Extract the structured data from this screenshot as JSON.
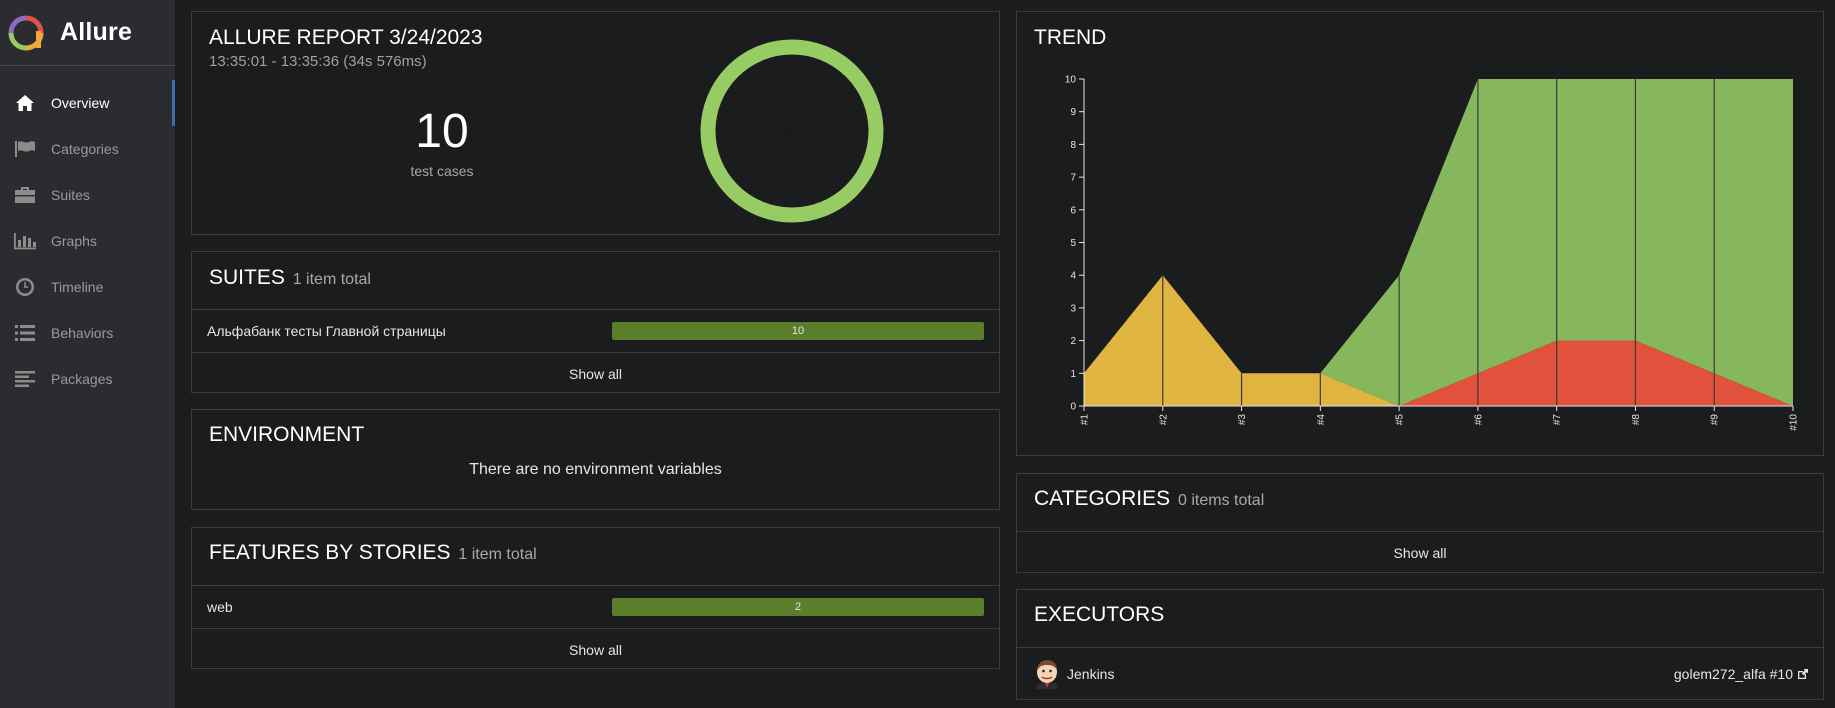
{
  "app": {
    "name": "Allure"
  },
  "sidebar": {
    "items": [
      {
        "label": "Overview",
        "icon": "home-icon",
        "active": true
      },
      {
        "label": "Categories",
        "icon": "flag-icon"
      },
      {
        "label": "Suites",
        "icon": "briefcase-icon"
      },
      {
        "label": "Graphs",
        "icon": "bar-chart-icon"
      },
      {
        "label": "Timeline",
        "icon": "clock-icon"
      },
      {
        "label": "Behaviors",
        "icon": "list-icon"
      },
      {
        "label": "Packages",
        "icon": "align-left-icon"
      }
    ]
  },
  "summary": {
    "title": "ALLURE REPORT 3/24/2023",
    "time": "13:35:01 - 13:35:36 (34s 576ms)",
    "count": "10",
    "count_label": "test cases",
    "percent": "100%",
    "pass_rate": 1.0,
    "color": "#97cc64"
  },
  "suites": {
    "title": "SUITES",
    "subtitle": "1 item total",
    "rows": [
      {
        "label": "Альфабанк тесты Главной страницы",
        "value": "10"
      }
    ],
    "show_all": "Show all"
  },
  "environment": {
    "title": "ENVIRONMENT",
    "message": "There are no environment variables"
  },
  "features": {
    "title": "FEATURES BY STORIES",
    "subtitle": "1 item total",
    "rows": [
      {
        "label": "web",
        "value": "2"
      }
    ],
    "show_all": "Show all"
  },
  "trend": {
    "title": "TREND"
  },
  "chart_data": {
    "type": "area",
    "categories": [
      "#1",
      "#2",
      "#3",
      "#4",
      "#5",
      "#6",
      "#7",
      "#8",
      "#9",
      "#10"
    ],
    "series": [
      {
        "key": "failed",
        "color": "#e0523b",
        "values": [
          0,
          0,
          0,
          0,
          0,
          1,
          2,
          2,
          1,
          0
        ]
      },
      {
        "key": "broken",
        "color": "#e0b440",
        "values": [
          1,
          4,
          1,
          1,
          0,
          0,
          0,
          0,
          0,
          0
        ]
      },
      {
        "key": "passed",
        "color": "#86b75d",
        "values": [
          0,
          0,
          0,
          0,
          4,
          9,
          8,
          8,
          9,
          10
        ]
      }
    ],
    "ylim": [
      0,
      10
    ],
    "yticks": [
      "0",
      "1",
      "2",
      "3",
      "4",
      "5",
      "6",
      "7",
      "8",
      "9",
      "10"
    ],
    "grid": true
  },
  "categories": {
    "title": "CATEGORIES",
    "subtitle": "0 items total",
    "show_all": "Show all"
  },
  "executors": {
    "title": "EXECUTORS",
    "name": "Jenkins",
    "link": "golem272_alfa #10"
  },
  "colors": {
    "bar": "#5b7e2b",
    "accent": "#3b6fb0"
  }
}
